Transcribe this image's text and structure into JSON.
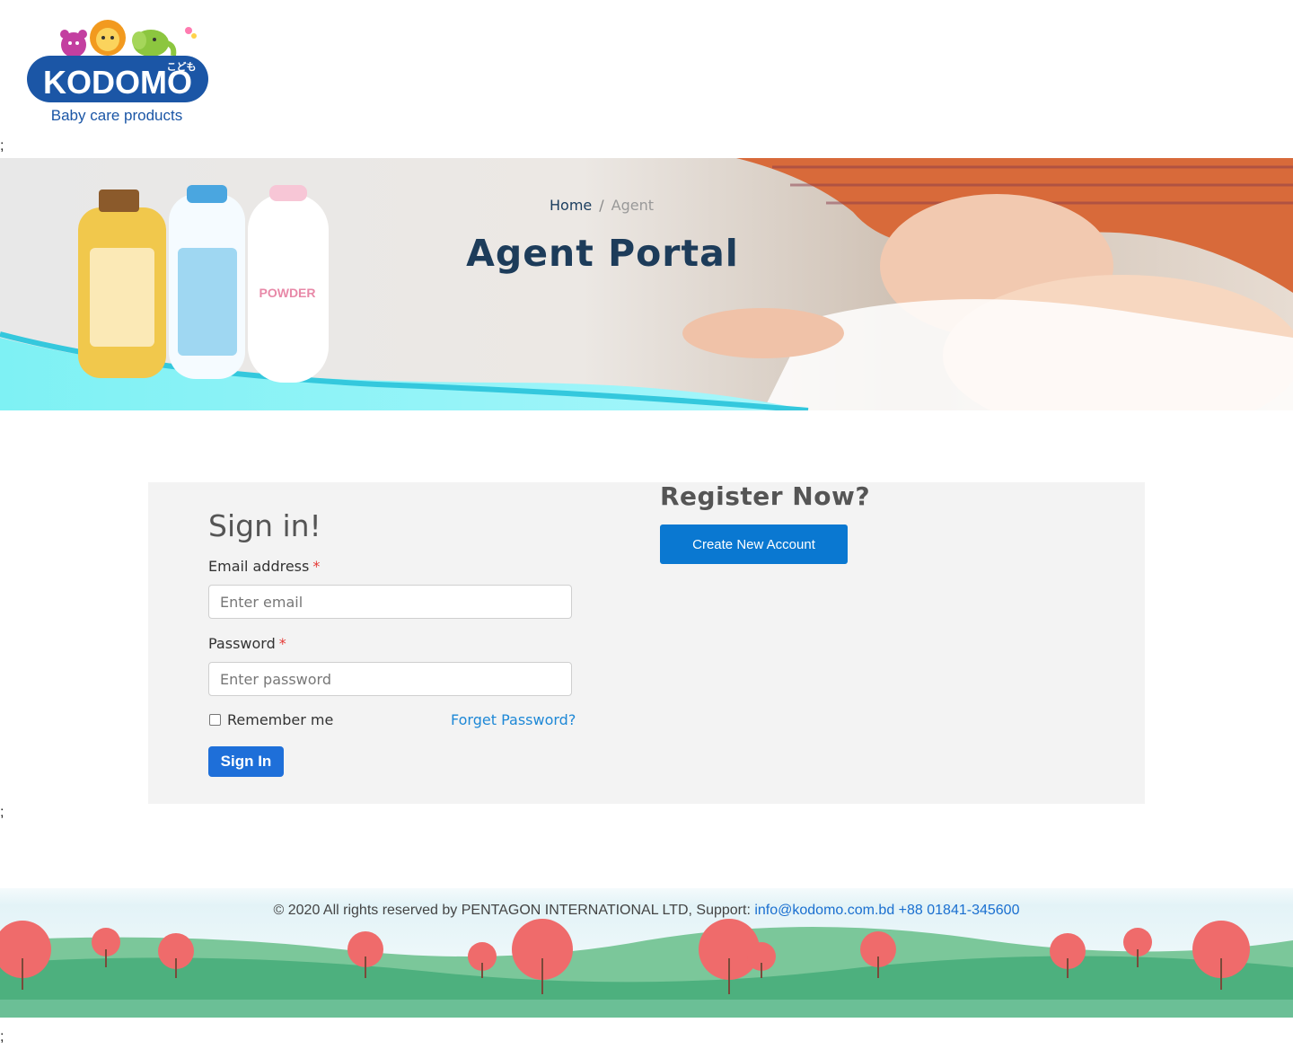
{
  "header": {
    "logo_text": "KODOMO",
    "logo_kana": "こども",
    "logo_tagline": "Baby care products",
    "stray_text": ";"
  },
  "banner": {
    "breadcrumb": {
      "home": "Home",
      "separator": "/",
      "current": "Agent"
    },
    "title": "Agent Portal"
  },
  "signin": {
    "title": "Sign in!",
    "email_label": "Email address",
    "email_placeholder": "Enter email",
    "email_value": "",
    "password_label": "Password",
    "password_placeholder": "Enter password",
    "password_value": "",
    "required_mark": "*",
    "remember_label": "Remember me",
    "remember_checked": false,
    "forgot_label": "Forget Password?",
    "submit_label": "Sign In"
  },
  "register": {
    "title": "Register Now?",
    "button_label": "Create New Account"
  },
  "footer": {
    "copyright": "© 2020 All rights reserved by PENTAGON INTERNATIONAL LTD, Support:",
    "email": "info@kodomo.com.bd",
    "phone": "+88 01841-345600"
  },
  "colors": {
    "primary_button": "#1e6fd9",
    "create_button": "#0a78d1",
    "link": "#1e88d6",
    "title_navy": "#1d3c5a",
    "panel_bg": "#f3f3f3",
    "required": "#e53935"
  }
}
